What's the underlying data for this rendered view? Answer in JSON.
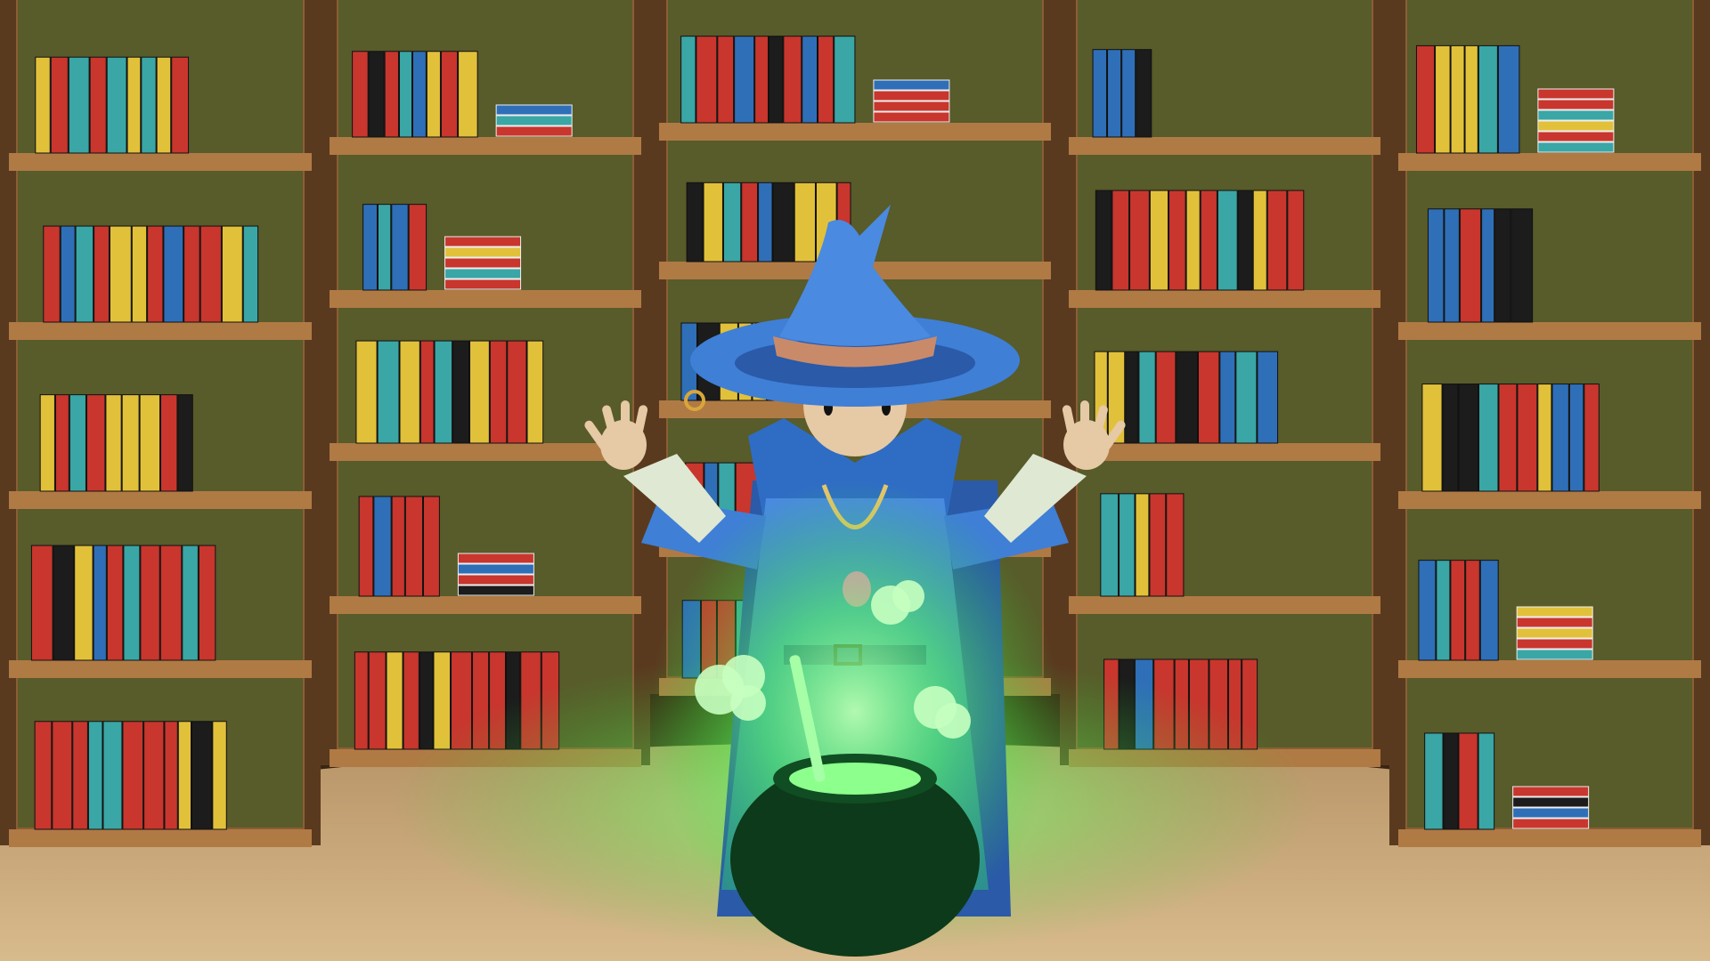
{
  "scene": {
    "subject": "cartoon-wizard",
    "setting": "library-bookshelves",
    "prop": "glowing-cauldron",
    "colors": {
      "wood_dark": "#5a3a1f",
      "wood": "#8b5e34",
      "wood_light": "#b07a45",
      "shelf_back": "#2f5a22",
      "floor": "#cfae7f",
      "floor_dark": "#a88860",
      "robe": "#3f7fd6",
      "robe_dark": "#2a5aa8",
      "hat": "#4a8ae0",
      "hat_band": "#c98a6a",
      "skin": "#e6c9a5",
      "sleeve": "#dfe8d2",
      "cauldron": "#0d3a1a",
      "glow": "#5cff5c",
      "book_red": "#c8362e",
      "book_blue": "#2f6fb8",
      "book_yellow": "#e2c13a",
      "book_teal": "#3aa6a6",
      "book_black": "#1c1c1c"
    }
  }
}
